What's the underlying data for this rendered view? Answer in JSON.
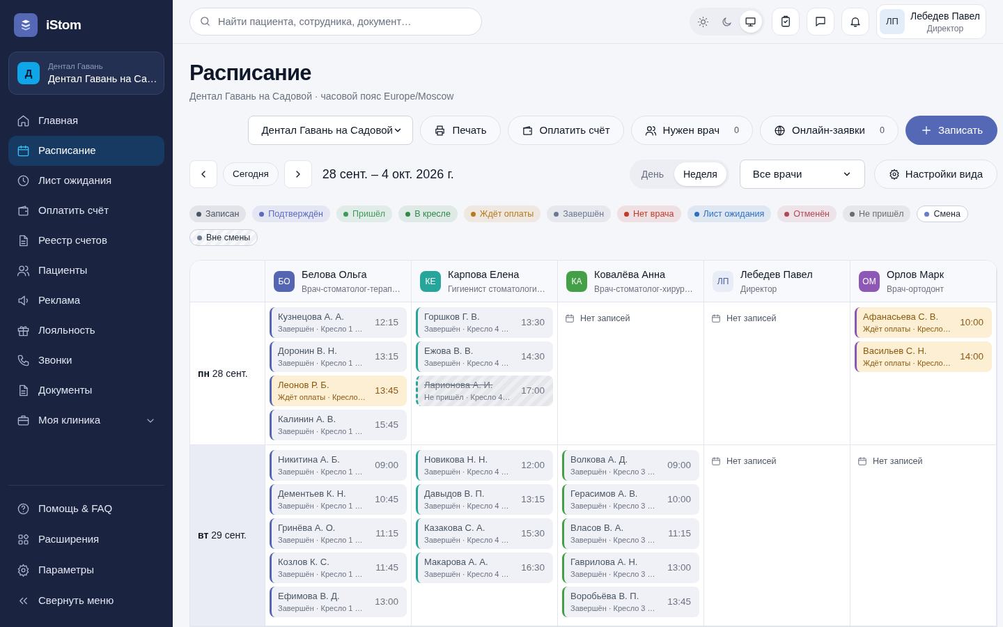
{
  "app": {
    "name": "iStom"
  },
  "clinic_switcher": {
    "avatar": "Д",
    "label": "Дентал Гавань",
    "value": "Дентал Гавань на Са…"
  },
  "sidebar": {
    "items": [
      {
        "label": "Главная",
        "selected": false
      },
      {
        "label": "Расписание",
        "selected": true
      },
      {
        "label": "Лист ожидания",
        "selected": false
      },
      {
        "label": "Оплатить счёт",
        "selected": false
      },
      {
        "label": "Реестр счетов",
        "selected": false
      },
      {
        "label": "Пациенты",
        "selected": false
      },
      {
        "label": "Реклама",
        "selected": false
      },
      {
        "label": "Лояльность",
        "selected": false
      },
      {
        "label": "Звонки",
        "selected": false
      },
      {
        "label": "Документы",
        "selected": false
      },
      {
        "label": "Моя клиника",
        "selected": false,
        "expanded": false
      }
    ],
    "footer_items": [
      {
        "label": "Помощь & FAQ"
      },
      {
        "label": "Расширения"
      },
      {
        "label": "Параметры"
      },
      {
        "label": "Свернуть меню"
      }
    ]
  },
  "topbar": {
    "search": {
      "placeholder": "Найти пациента, сотрудника, документ…"
    },
    "theme_options": [
      {
        "selected": false
      },
      {
        "selected": false
      },
      {
        "selected": true
      }
    ],
    "user": {
      "initials": "ЛП",
      "name": "Лебедев Павел",
      "role": "Директор"
    }
  },
  "page": {
    "title": "Расписание",
    "subtitle": "Дентал Гавань на Садовой · часовой пояс Europe/Moscow"
  },
  "actions": {
    "clinic_select": "Дентал Гавань на Садовой",
    "buttons": [
      {
        "kind": "plain",
        "label": "Печать"
      },
      {
        "kind": "plain",
        "label": "Оплатить счёт"
      },
      {
        "kind": "counter",
        "label": "Нужен врач",
        "count": "0"
      },
      {
        "kind": "counter",
        "label": "Онлайн-заявки",
        "count": "0"
      },
      {
        "kind": "primary",
        "label": "Записать"
      }
    ]
  },
  "navigation": {
    "today": "Сегодня",
    "range": "28 сент. – 4 окт. 2026 г.",
    "views": [
      {
        "label": "День",
        "selected": false
      },
      {
        "label": "Неделя",
        "selected": true
      }
    ],
    "doctor_filter": "Все врачи",
    "settings": "Настройки вида"
  },
  "legend": [
    {
      "kind": "status",
      "label": "Записан",
      "color": "#4b5563"
    },
    {
      "kind": "status",
      "label": "Подтверждён",
      "color": "#5b6bbf"
    },
    {
      "kind": "status",
      "label": "Пришёл",
      "color": "#3f9a5c"
    },
    {
      "kind": "status",
      "label": "В кресле",
      "color": "#2f8a4a"
    },
    {
      "kind": "status",
      "label": "Ждёт оплаты",
      "color": "#b7791f"
    },
    {
      "kind": "status",
      "label": "Завершён",
      "color": "#6b7a90"
    },
    {
      "kind": "status",
      "label": "Нет врача",
      "color": "#c0392b"
    },
    {
      "kind": "status",
      "label": "Лист ожидания",
      "color": "#2f6fc0"
    },
    {
      "kind": "status",
      "label": "Отменён",
      "color": "#b04a5a"
    },
    {
      "kind": "status",
      "label": "Не пришёл",
      "color": "#6b6b70"
    },
    {
      "kind": "shift",
      "label": "Смена",
      "color": "#6b7bc8"
    },
    {
      "kind": "off_shift",
      "label": "Вне смены",
      "color": "#6b7a90"
    }
  ],
  "schedule": {
    "doctors": [
      {
        "initials": "БО",
        "name": "Белова Ольга",
        "role": "Врач-стоматолог-терап…",
        "color": "#5466b3"
      },
      {
        "initials": "КЕ",
        "name": "Карпова Елена",
        "role": "Гигиенист стоматологи…",
        "color": "#26a69a"
      },
      {
        "initials": "КА",
        "name": "Ковалёва Анна",
        "role": "Врач-стоматолог-хирур…",
        "color": "#43a047"
      },
      {
        "initials": "ЛП",
        "name": "Лебедев Павел",
        "role": "Директор",
        "color": "#e8ecf7"
      },
      {
        "initials": "ОМ",
        "name": "Орлов Марк",
        "role": "Врач-ортодонт",
        "color": "#8e57b5"
      }
    ],
    "days": [
      {
        "label": "**пн** 28 сент.",
        "today": false,
        "cells": [
          {
            "appointments": [
              {
                "kind": "completed",
                "patient": "Кузнецова А. А.",
                "details": "Завершён · Кресло 1 …",
                "time": "12:15"
              },
              {
                "kind": "completed",
                "patient": "Доронин В. Н.",
                "details": "Завершён · Кресло 1 …",
                "time": "13:15"
              },
              {
                "kind": "awaiting_payment",
                "patient": "Леонов Р. Б.",
                "details": "Ждёт оплаты · Кресло…",
                "time": "13:45"
              },
              {
                "kind": "completed",
                "patient": "Калинин А. В.",
                "details": "Завершён · Кресло 1 …",
                "time": "15:45"
              }
            ]
          },
          {
            "appointments": [
              {
                "kind": "completed",
                "patient": "Горшков Г. В.",
                "details": "Завершён · Кресло 4 …",
                "time": "13:30"
              },
              {
                "kind": "completed",
                "patient": "Ежова В. В.",
                "details": "Завершён · Кресло 4 …",
                "time": "14:30"
              },
              {
                "kind": "no_show",
                "patient": "Ларионова А. И.",
                "details": "Не пришёл · Кресло 4…",
                "time": "17:00"
              }
            ]
          },
          {
            "empty_text": "Нет записей"
          },
          {
            "empty_text": "Нет записей"
          },
          {
            "appointments": [
              {
                "kind": "awaiting_payment",
                "patient": "Афанасьева С. В.",
                "details": "Ждёт оплаты · Кресло…",
                "time": "10:00"
              },
              {
                "kind": "awaiting_payment",
                "patient": "Васильев С. Н.",
                "details": "Ждёт оплаты · Кресло…",
                "time": "14:00"
              }
            ]
          }
        ]
      },
      {
        "label": "**вт** 29 сент.",
        "today": true,
        "cells": [
          {
            "appointments": [
              {
                "kind": "completed",
                "patient": "Никитина А. Б.",
                "details": "Завершён · Кресло 1 …",
                "time": "09:00"
              },
              {
                "kind": "completed",
                "patient": "Дементьев К. Н.",
                "details": "Завершён · Кресло 1 …",
                "time": "10:45"
              },
              {
                "kind": "completed",
                "patient": "Гринёва А. О.",
                "details": "Завершён · Кресло 1 …",
                "time": "11:15"
              },
              {
                "kind": "completed",
                "patient": "Козлов К. С.",
                "details": "Завершён · Кресло 1 …",
                "time": "11:45"
              },
              {
                "kind": "completed",
                "patient": "Ефимова В. Д.",
                "details": "Завершён · Кресло 1 …",
                "time": "13:00"
              }
            ]
          },
          {
            "appointments": [
              {
                "kind": "completed",
                "patient": "Новикова Н. Н.",
                "details": "Завершён · Кресло 4 …",
                "time": "12:00"
              },
              {
                "kind": "completed",
                "patient": "Давыдов В. П.",
                "details": "Завершён · Кресло 4 …",
                "time": "13:15"
              },
              {
                "kind": "completed",
                "patient": "Казакова С. А.",
                "details": "Завершён · Кресло 4 …",
                "time": "15:30"
              },
              {
                "kind": "completed",
                "patient": "Макарова А. А.",
                "details": "Завершён · Кресло 4 …",
                "time": "16:30"
              }
            ]
          },
          {
            "appointments": [
              {
                "kind": "completed",
                "patient": "Волкова А. Д.",
                "details": "Завершён · Кресло 3 …",
                "time": "09:00"
              },
              {
                "kind": "completed",
                "patient": "Герасимов А. В.",
                "details": "Завершён · Кресло 3 …",
                "time": "10:00"
              },
              {
                "kind": "completed",
                "patient": "Власов В. А.",
                "details": "Завершён · Кресло 3 …",
                "time": "11:15"
              },
              {
                "kind": "completed",
                "patient": "Гаврилова А. Н.",
                "details": "Завершён · Кресло 3 …",
                "time": "13:00"
              },
              {
                "kind": "completed",
                "patient": "Воробьёва В. П.",
                "details": "Завершён · Кресло 3 …",
                "time": "13:45"
              }
            ]
          },
          {
            "empty_text": "Нет записей"
          },
          {
            "empty_text": "Нет записей"
          }
        ]
      }
    ]
  }
}
